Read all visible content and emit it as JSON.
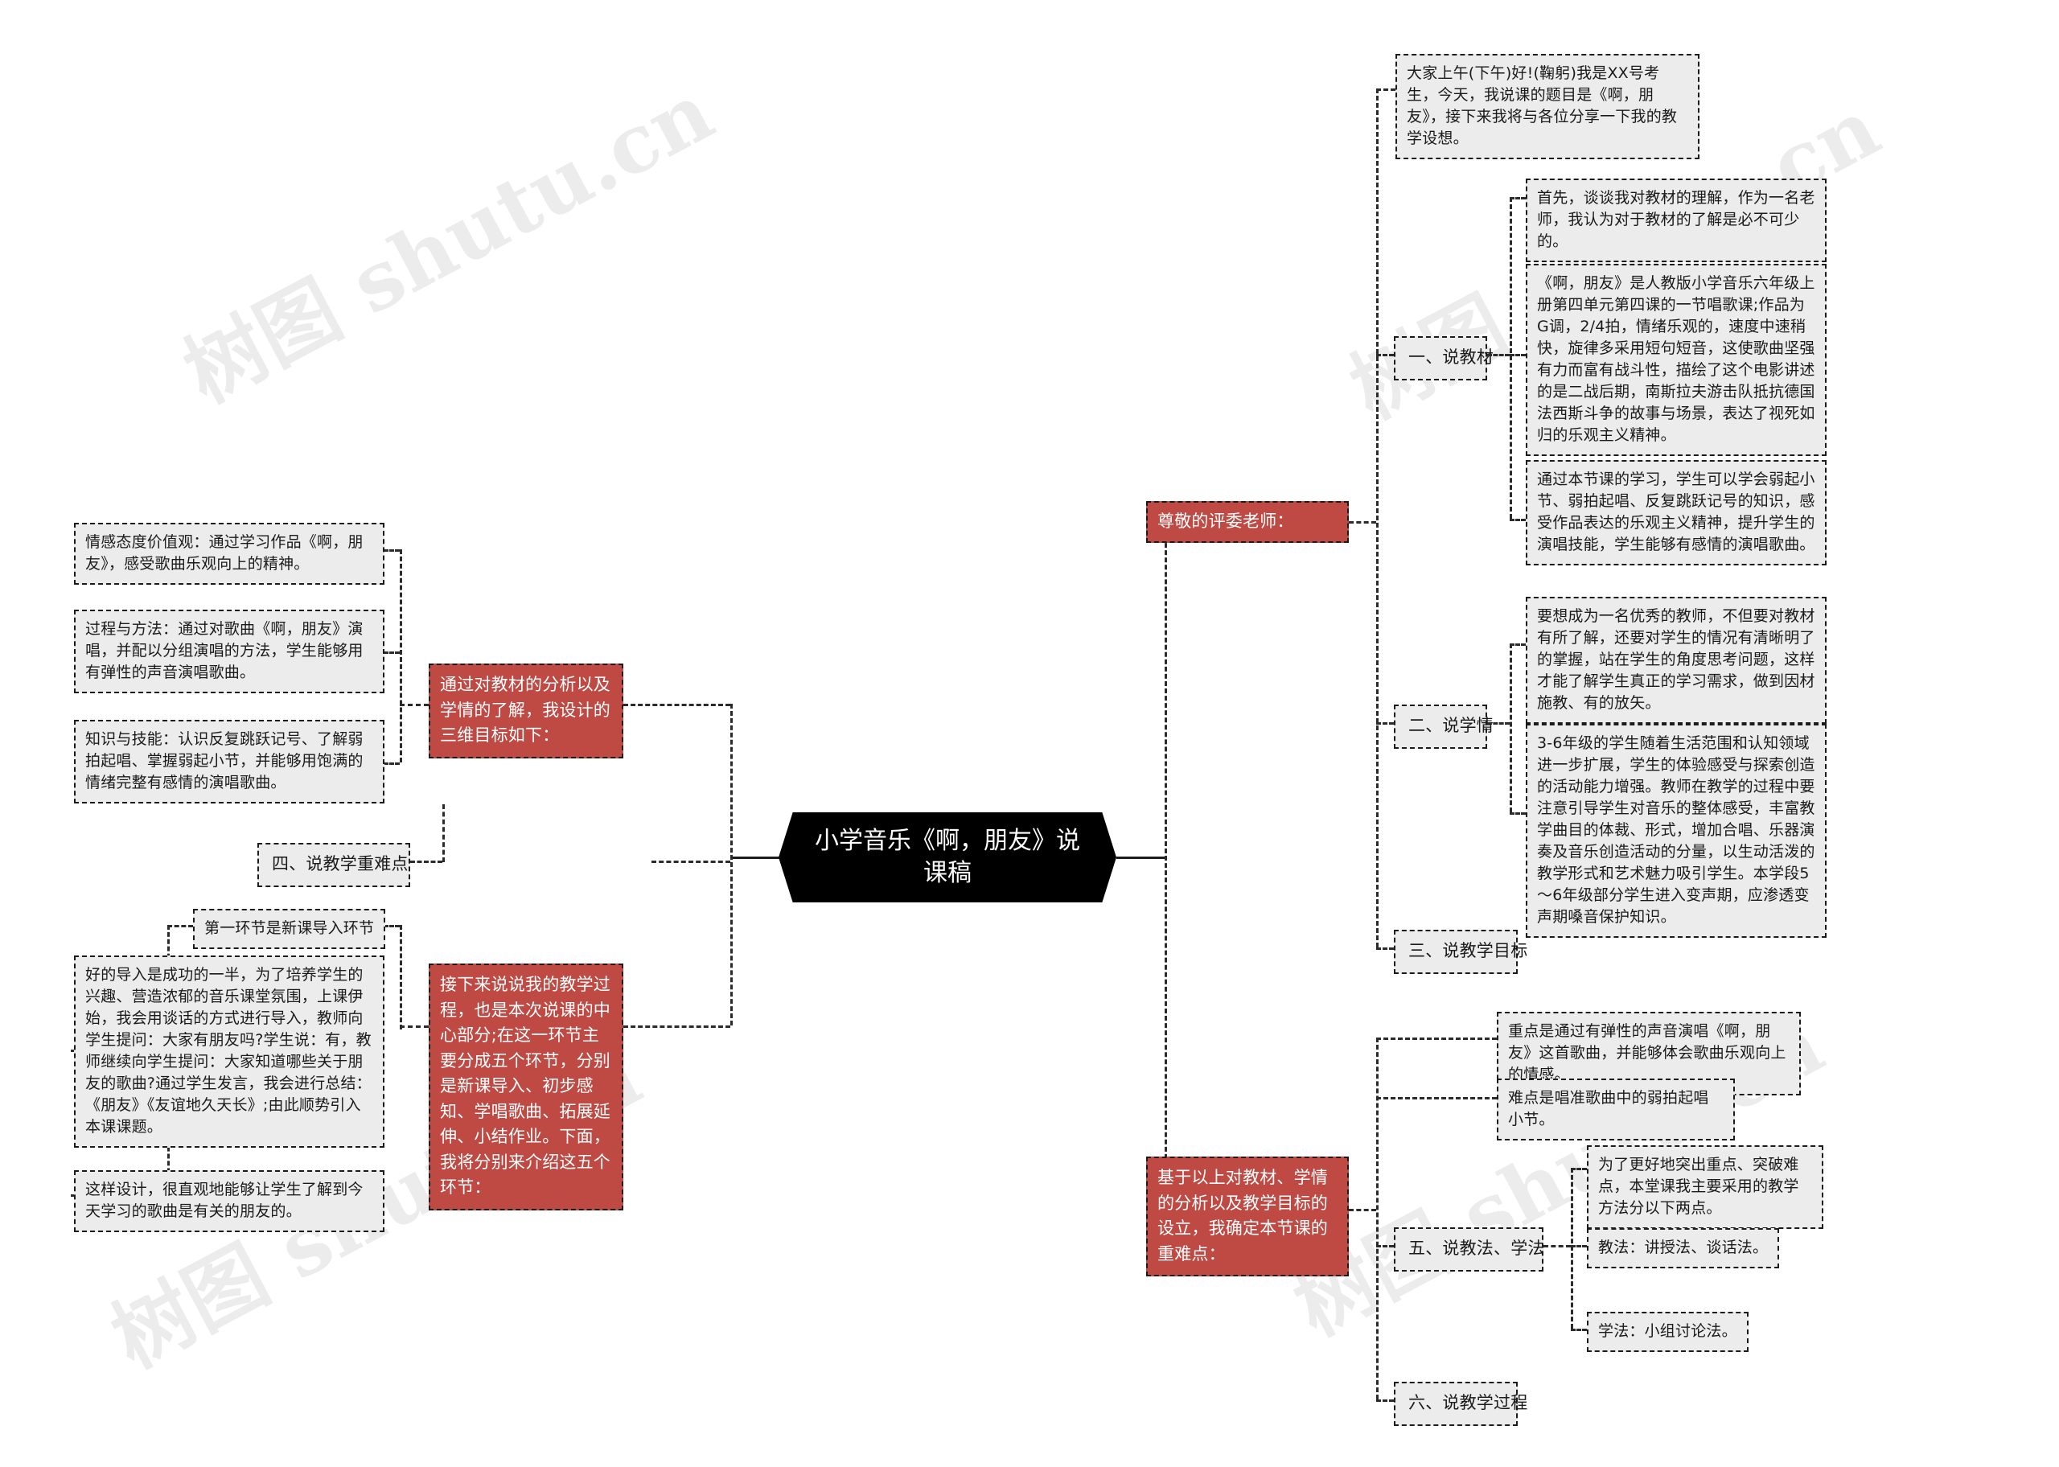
{
  "center": {
    "title": "小学音乐《啊，朋友》说课稿"
  },
  "watermarks": [
    "树图 shutu.cn",
    "树图 shutu.cn",
    "树图 shutu.cn",
    "树图 shutu.cn"
  ],
  "right": {
    "greeting_branch": {
      "label": "尊敬的评委老师：",
      "detail": "大家上午(下午)好!(鞠躬)我是XX号考生，今天，我说课的题目是《啊，朋友》，接下来我将与各位分享一下我的教学设想。"
    },
    "branches": [
      {
        "label": "一、说教材",
        "items": [
          "首先，谈谈我对教材的理解，作为一名老师，我认为对于教材的了解是必不可少的。",
          "《啊，朋友》是人教版小学音乐六年级上册第四单元第四课的一节唱歌课;作品为G调，2/4拍，情绪乐观的，速度中速稍快，旋律多采用短句短音，这使歌曲坚强有力而富有战斗性，描绘了这个电影讲述的是二战后期，南斯拉夫游击队抵抗德国法西斯斗争的故事与场景，表达了视死如归的乐观主义精神。",
          "通过本节课的学习，学生可以学会弱起小节、弱拍起唱、反复跳跃记号的知识，感受作品表达的乐观主义精神，提升学生的演唱技能，学生能够有感情的演唱歌曲。"
        ]
      },
      {
        "label": "二、说学情",
        "items": [
          "要想成为一名优秀的教师，不但要对教材有所了解，还要对学生的情况有清晰明了的掌握，站在学生的角度思考问题，这样才能了解学生真正的学习需求，做到因材施教、有的放矢。",
          "3-6年级的学生随着生活范围和认知领域进一步扩展，学生的体验感受与探索创造的活动能力增强。教师在教学的过程中要注意引导学生对音乐的整体感受，丰富教学曲目的体裁、形式，增加合唱、乐器演奏及音乐创造活动的分量，以生动活泼的教学形式和艺术魅力吸引学生。本学段5～6年级部分学生进入变声期，应渗透变声期嗓音保护知识。"
        ]
      },
      {
        "label": "三、说教学目标",
        "items": []
      }
    ],
    "key_points_branch": {
      "label": "基于以上对教材、学情的分析以及教学目标的设立，我确定本节课的重难点：",
      "items": [
        "重点是通过有弹性的声音演唱《啊，朋友》这首歌曲，并能够体会歌曲乐观向上的情感。",
        "难点是唱准歌曲中的弱拍起唱小节。"
      ]
    },
    "method_branch": {
      "label": "五、说教法、学法",
      "intro": "为了更好地突出重点、突破难点，本堂课我主要采用的教学方法分以下两点。",
      "items": [
        "教法：讲授法、谈话法。",
        "学法：小组讨论法。"
      ]
    },
    "process_branch": {
      "label": "六、说教学过程"
    }
  },
  "left": {
    "goals_branch": {
      "label": "通过对教材的分析以及学情的了解，我设计的三维目标如下：",
      "items": [
        "情感态度价值观：通过学习作品《啊，朋友》，感受歌曲乐观向上的精神。",
        "过程与方法：通过对歌曲《啊，朋友》演唱，并配以分组演唱的方法，学生能够用有弹性的声音演唱歌曲。",
        "知识与技能：认识反复跳跃记号、了解弱拍起唱、掌握弱起小节，并能够用饱满的情绪完整有感情的演唱歌曲。"
      ]
    },
    "difficulty_branch": {
      "label": "四、说教学重难点"
    },
    "process_branch": {
      "label": "接下来说说我的教学过程，也是本次说课的中心部分;在这一环节主要分成五个环节，分别是新课导入、初步感知、学唱歌曲、拓展延伸、小结作业。下面，我将分别来介绍这五个环节：",
      "steps": [
        {
          "label": "第一环节是新课导入环节",
          "items": [
            "好的导入是成功的一半，为了培养学生的兴趣、营造浓郁的音乐课堂氛围，上课伊始，我会用谈话的方式进行导入，教师向学生提问：大家有朋友吗?学生说：有，教师继续向学生提问：大家知道哪些关于朋友的歌曲?通过学生发言，我会进行总结：《朋友》《友谊地久天长》;由此顺势引入本课课题。",
            "这样设计，很直观地能够让学生了解到今天学习的歌曲是有关的朋友的。"
          ]
        }
      ]
    }
  }
}
